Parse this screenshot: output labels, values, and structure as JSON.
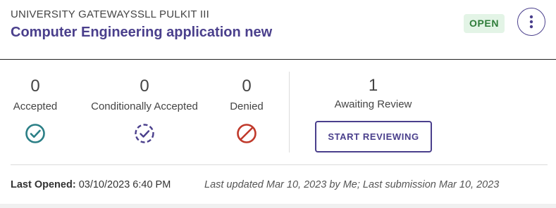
{
  "header": {
    "organization": "UNIVERSITY GATEWAYSSLL PULKIT III",
    "title": "Computer Engineering application new",
    "status": "OPEN",
    "status_color": "#2f7d3a",
    "menu_icon": "more-vertical-icon"
  },
  "stats": [
    {
      "value": "0",
      "label": "Accepted",
      "icon": "check-circle-icon",
      "color": "#2b7f86"
    },
    {
      "value": "0",
      "label": "Conditionally Accepted",
      "icon": "check-circle-dashed-icon",
      "color": "#4a3f8c"
    },
    {
      "value": "0",
      "label": "Denied",
      "icon": "block-icon",
      "color": "#c0392b"
    }
  ],
  "awaiting": {
    "value": "1",
    "label": "Awaiting Review",
    "button_label": "START REVIEWING"
  },
  "footer": {
    "last_opened_label": "Last Opened:",
    "last_opened_value": "03/10/2023 6:40 PM",
    "updated_text": "Last updated Mar 10, 2023 by Me; Last submission Mar 10, 2023"
  },
  "colors": {
    "brand": "#4a3f8c",
    "badge_bg": "#e3f4e6"
  }
}
